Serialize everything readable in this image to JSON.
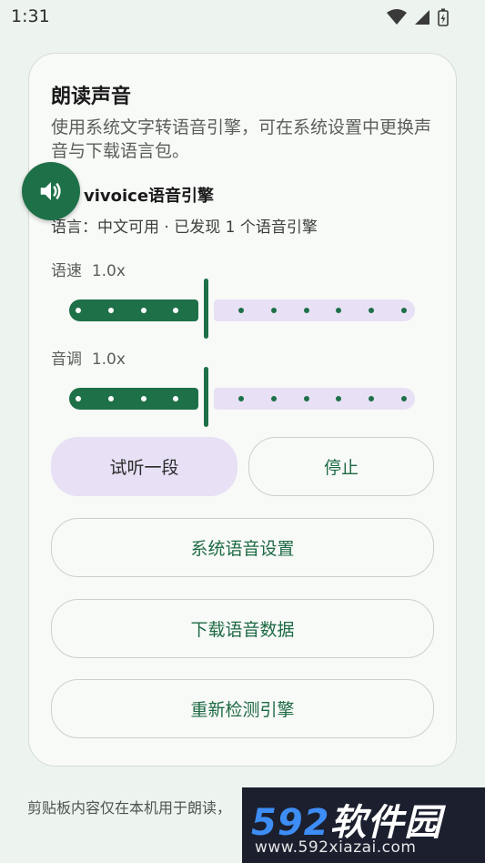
{
  "status_bar": {
    "time": "1:31"
  },
  "card": {
    "title": "朗读声音",
    "description": "使用系统文字转语音引擎，可在系统设置中更换声音与下载语言包。",
    "engine_label": "擎：vivoice语音引擎",
    "language_info": "语言：中文可用 · 已发现 1 个语音引擎"
  },
  "sliders": {
    "rate": {
      "label": "语速",
      "value_text": "1.0x",
      "fraction": 0.39
    },
    "pitch": {
      "label": "音调",
      "value_text": "1.0x",
      "fraction": 0.39
    }
  },
  "buttons": {
    "preview": "试听一段",
    "stop": "停止",
    "system_tts_settings": "系统语音设置",
    "download_voice_data": "下载语音数据",
    "redetect_engine": "重新检测引擎"
  },
  "footer": {
    "text": "剪贴板内容仅在本机用于朗读，"
  },
  "watermark": {
    "title_num": "592",
    "title_text": "软件园",
    "url": "www.592xiazai.com"
  },
  "colors": {
    "accent": "#1e7048",
    "inactive_track": "#e8e0f5",
    "background": "#edf3ee"
  },
  "icons": [
    "wifi-icon",
    "cell-signal-icon",
    "battery-icon",
    "volume-icon"
  ]
}
